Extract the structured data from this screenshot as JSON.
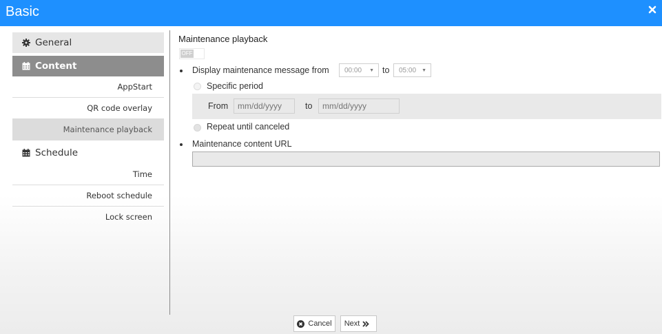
{
  "window": {
    "title": "Basic",
    "close_icon": "close-icon"
  },
  "sidebar": {
    "general": {
      "label": "General",
      "icon": "gear-icon"
    },
    "content": {
      "label": "Content",
      "icon": "calendar-icon",
      "items": [
        {
          "label": "AppStart"
        },
        {
          "label": "QR code overlay"
        },
        {
          "label": "Maintenance playback",
          "active": true
        }
      ]
    },
    "schedule": {
      "label": "Schedule",
      "icon": "calendar-icon",
      "items": [
        {
          "label": "Time"
        },
        {
          "label": "Reboot schedule"
        },
        {
          "label": "Lock screen"
        }
      ]
    }
  },
  "main": {
    "section_title": "Maintenance playback",
    "toggle_label": "OFF",
    "display_label": "Display maintenance message from",
    "from_time": "00:00",
    "to_label": "to",
    "to_time": "05:00",
    "specific_period_label": "Specific period",
    "from_label": "From",
    "date_placeholder_from": "mm/dd/yyyy",
    "date_to_label": "to",
    "date_placeholder_to": "mm/dd/yyyy",
    "repeat_label": "Repeat until canceled",
    "url_label": "Maintenance content URL",
    "url_value": ""
  },
  "footer": {
    "cancel_label": "Cancel",
    "next_label": "Next"
  },
  "colors": {
    "titlebar": "#1e90ff",
    "active_nav": "#8d8d8d",
    "active_sub": "#dcdcdc"
  }
}
